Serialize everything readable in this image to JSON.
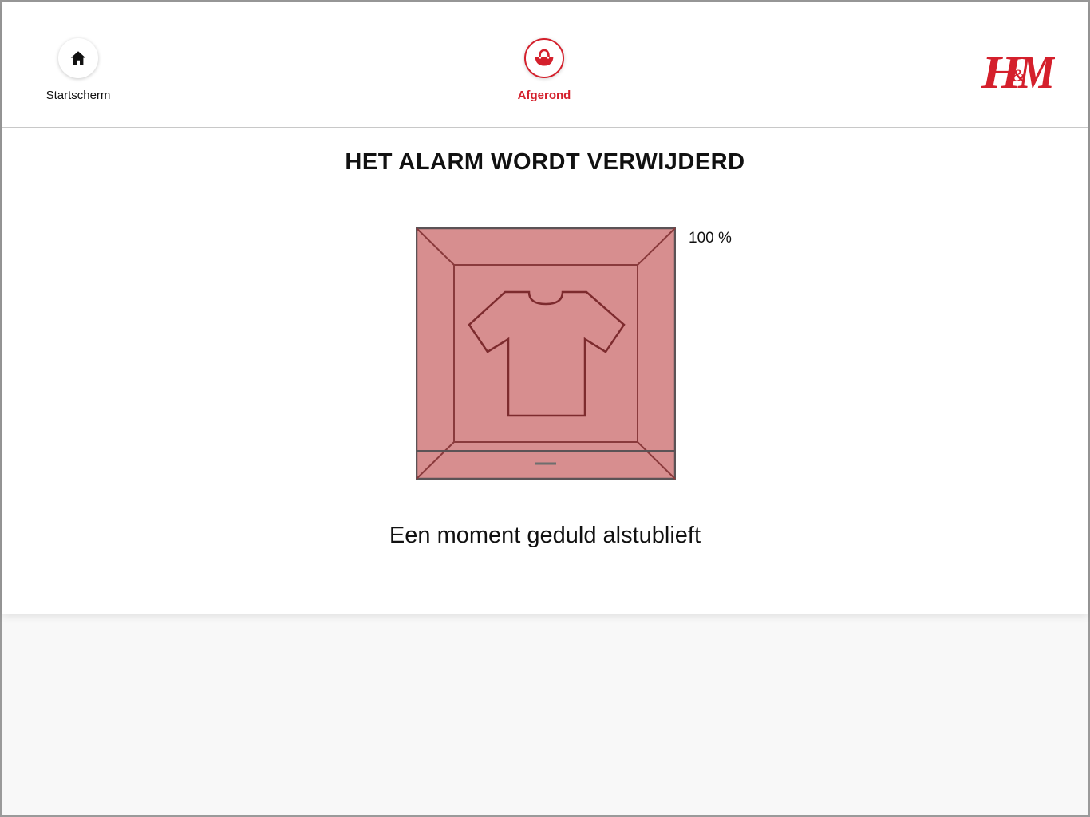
{
  "nav": {
    "home_label": "Startscherm",
    "home_icon": "home-icon",
    "done_label": "Afgerond",
    "done_icon": "shopping-bag-icon"
  },
  "brand": {
    "logo_text": "H&M",
    "color": "#d4202c"
  },
  "main": {
    "title": "HET ALARM WORDT VERWIJDERD",
    "progress_text": "100 %",
    "progress_fraction": 1.0,
    "message": "Een moment geduld alstublieft"
  },
  "colors": {
    "accent": "#d4202c",
    "box_fill": "#d78e8f",
    "box_line": "#7d2b2e"
  }
}
